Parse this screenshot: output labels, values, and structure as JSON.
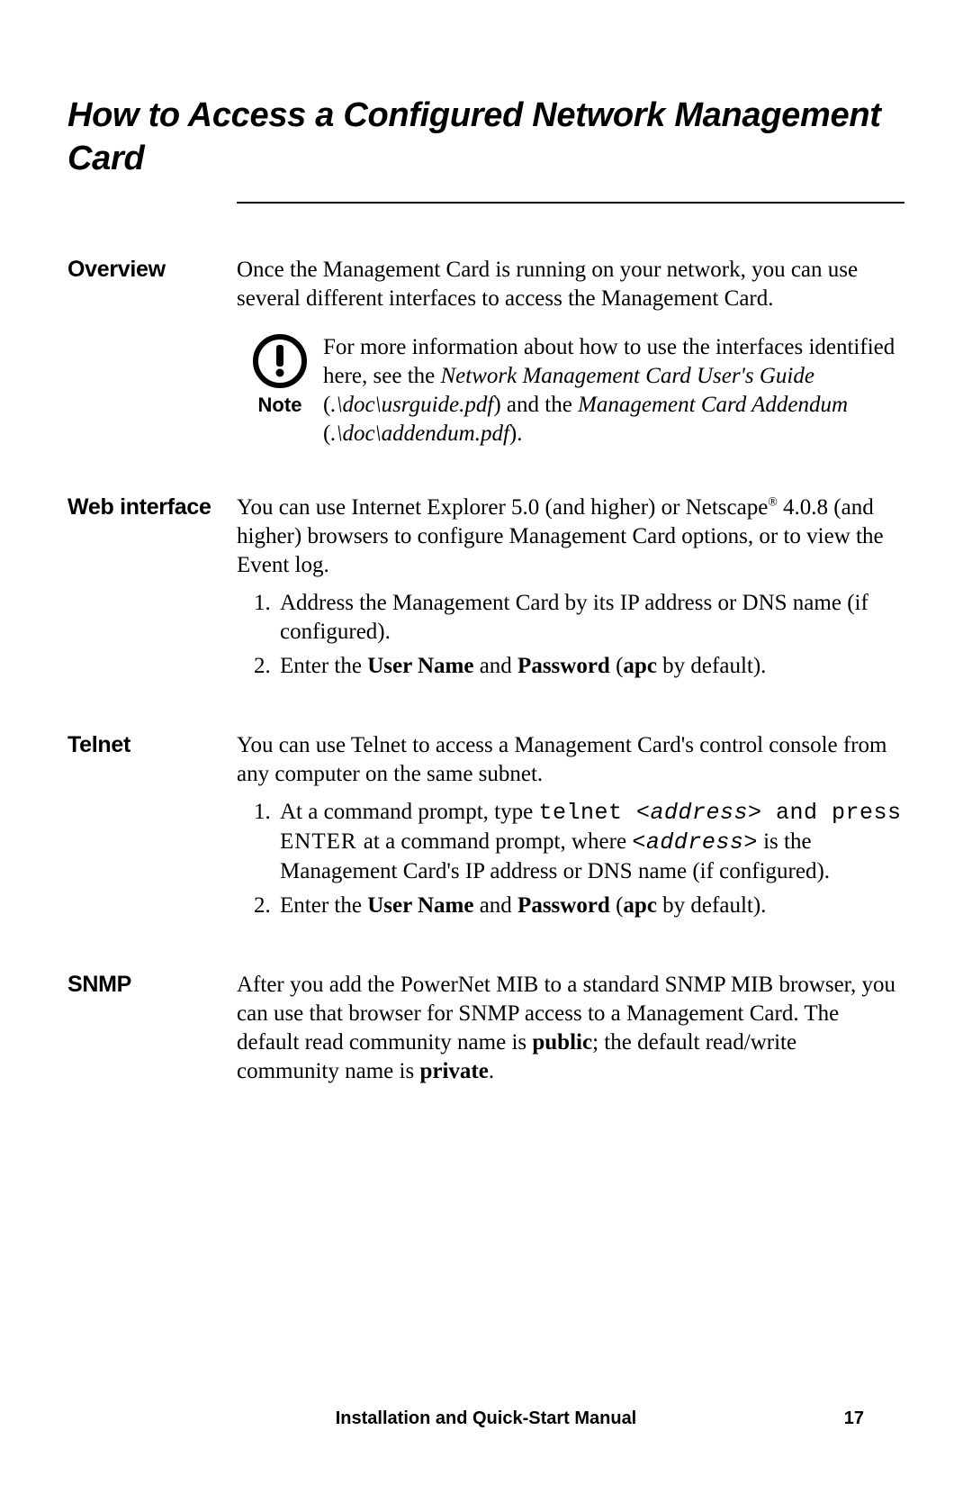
{
  "title": "How to Access a Configured Network Management Card",
  "sections": {
    "overview": {
      "label": "Overview",
      "intro": "Once the Management Card is running on your network, you can use several different interfaces to access the Management Card.",
      "note_label": "Note",
      "note_pre": "For more information about how to use the interfaces identified here, see the ",
      "note_i1": "Network Management Card User's Guide",
      "note_mid1": " (",
      "note_p1": ".\\doc\\usrguide.pdf",
      "note_mid2": ") and the ",
      "note_i2": "Management Card Addendum",
      "note_mid3": " (",
      "note_p2": ".\\doc\\addendum.pdf",
      "note_end": ")."
    },
    "web": {
      "label": "Web interface",
      "intro_a": "You can use Internet Explorer 5.0 (and higher) or Netscape",
      "reg": "®",
      "intro_b": " 4.0.8 (and higher) browsers to configure Management Card options, or to view the Event log.",
      "step1": "Address the Management Card by its IP address or DNS name (if configured).",
      "step2_a": "Enter the ",
      "step2_b1": "User Name",
      "step2_b": " and ",
      "step2_b2": "Password",
      "step2_c": " (",
      "step2_b3": "apc",
      "step2_d": " by default)."
    },
    "telnet": {
      "label": "Telnet",
      "intro": "You can use Telnet to access a Management Card's control console from any computer on the same subnet.",
      "s1_a": "At a command prompt, type ",
      "s1_m1": "telnet ",
      "s1_m2": "<address>",
      "s1_m3": " and press",
      "s1_enter": " ENTER ",
      "s1_b": "at a command prompt, where ",
      "s1_m4": "<address>",
      "s1_c": " is the Management Card's IP address or DNS name (if configured).",
      "s2_a": "Enter the ",
      "s2_b1": "User Name",
      "s2_b": " and ",
      "s2_b2": "Password",
      "s2_c": " (",
      "s2_b3": "apc",
      "s2_d": " by default)."
    },
    "snmp": {
      "label": "SNMP",
      "a": "After you add the PowerNet MIB to a standard SNMP MIB browser, you can use that browser for SNMP access to a Management Card. The default read community name is ",
      "b1": "public",
      "b": "; the default read/write community name is ",
      "b2": "private",
      "c": "."
    }
  },
  "footer": "Installation and Quick-Start Manual",
  "page": "17"
}
